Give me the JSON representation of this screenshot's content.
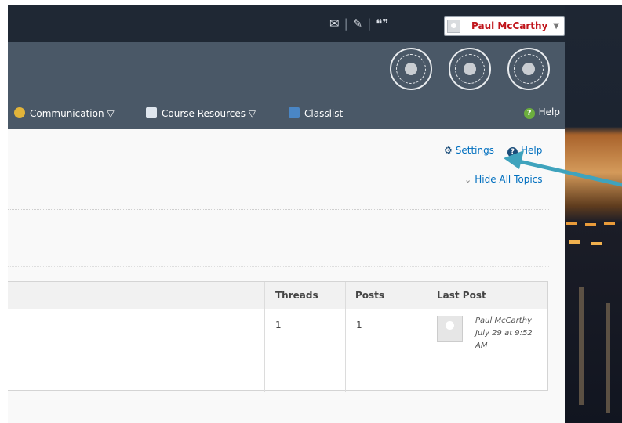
{
  "topbar": {
    "icons": [
      "message-icon",
      "update-icon",
      "subscription-icon"
    ],
    "user_name": "Paul McCarthy"
  },
  "navbar": {
    "items": [
      {
        "label": "Communication ▽",
        "icon": "communication-icon"
      },
      {
        "label": "Course Resources ▽",
        "icon": "course-resources-icon"
      },
      {
        "label": "Classlist",
        "icon": "classlist-icon"
      }
    ],
    "help_label": "Help"
  },
  "page": {
    "settings_label": "Settings",
    "help_label": "Help",
    "hide_topics_label": "Hide All Topics"
  },
  "table": {
    "headers": [
      "Threads",
      "Posts",
      "Last Post"
    ],
    "row": {
      "threads": "1",
      "posts": "1",
      "last_post_author": "Paul McCarthy",
      "last_post_date": "July 29 at 9:52 AM"
    }
  },
  "colors": {
    "topbar": "#1f2834",
    "banner": "#4a5867",
    "link": "#006fbf",
    "annotation_arrow": "#3fa3bd",
    "user_name": "#c0151b"
  }
}
